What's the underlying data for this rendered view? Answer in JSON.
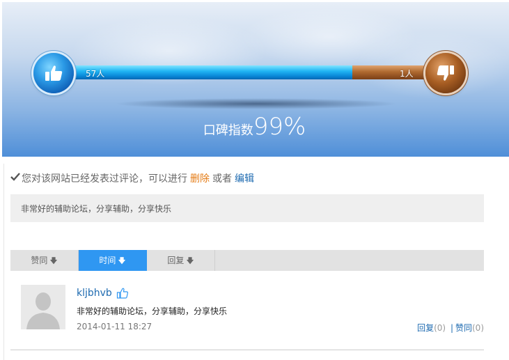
{
  "rating": {
    "likes_label": "57人",
    "dislikes_label": "1人",
    "like_fraction": 0.78,
    "score_label": "口碑指数",
    "score_value": "99%"
  },
  "notice": {
    "text": "您对该网站已经发表过评论，可以进行",
    "delete_label": "删除",
    "or_text": "或者",
    "edit_label": "编辑"
  },
  "review": {
    "text": "非常好的辅助论坛，分享辅助，分享快乐"
  },
  "sort_tabs": [
    {
      "label": "赞同",
      "active": false
    },
    {
      "label": "时间",
      "active": true
    },
    {
      "label": "回复",
      "active": false
    }
  ],
  "comment": {
    "username": "kljbhvb",
    "text": "非常好的辅助论坛，分享辅助，分享快乐",
    "date": "2014-01-11 18:27",
    "reply_label": "回复",
    "reply_count": "(0)",
    "separator": "|",
    "like_label": "赞同",
    "like_count": "(0)"
  },
  "colors": {
    "accent_blue": "#2f97f2",
    "link_blue": "#1d6ab0",
    "delete_orange": "#e47c16"
  },
  "icons": {
    "like": "thumbs-up-icon",
    "dislike": "thumbs-down-icon",
    "check": "check-icon",
    "sort_arrow": "arrow-down-icon",
    "avatar": "default-avatar-icon"
  }
}
